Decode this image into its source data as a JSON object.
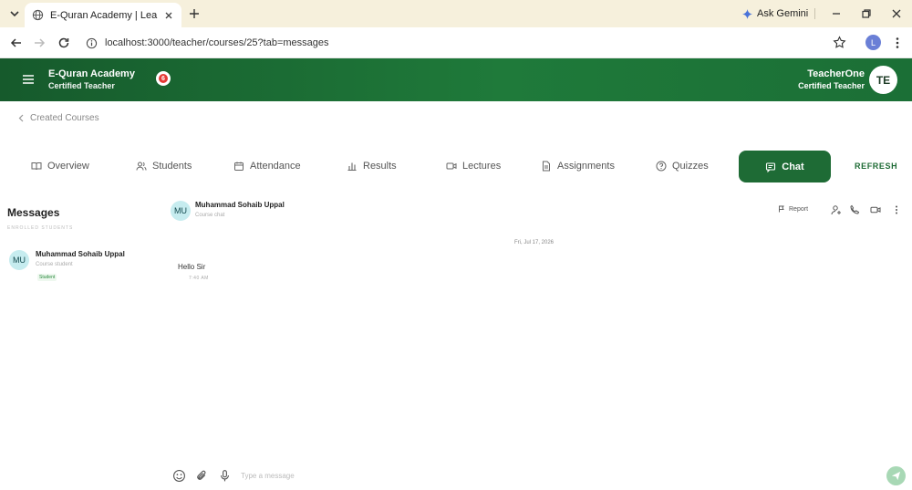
{
  "browser": {
    "tab_title": "E-Quran Academy | Learn Qur...",
    "gemini_label": "Ask Gemini",
    "url": "localhost:3000/teacher/courses/25?tab=messages",
    "profile_initial": "L"
  },
  "header": {
    "brand_name": "E-Quran Academy",
    "brand_sub": "Certified Teacher",
    "notification_count": "6",
    "user_name": "TeacherOne",
    "user_sub": "Certified Teacher",
    "user_initials": "TE"
  },
  "breadcrumb": {
    "back_label": "Created Courses"
  },
  "course_tabs": [
    {
      "label": "Overview",
      "icon": "book-icon"
    },
    {
      "label": "Students",
      "icon": "users-icon"
    },
    {
      "label": "Attendance",
      "icon": "calendar-icon"
    },
    {
      "label": "Results",
      "icon": "bar-chart-icon"
    },
    {
      "label": "Lectures",
      "icon": "video-icon"
    },
    {
      "label": "Assignments",
      "icon": "file-icon"
    },
    {
      "label": "Quizzes",
      "icon": "help-circle-icon"
    },
    {
      "label": "Chat",
      "icon": "chat-icon",
      "active": true
    }
  ],
  "refresh_label": "REFRESH",
  "messages_panel": {
    "title": "Messages",
    "section_label": "ENROLLED STUDENTS",
    "contacts": [
      {
        "initials": "MU",
        "name": "Muhammad Sohaib Uppal",
        "role": "Course student",
        "badge": "Student"
      }
    ]
  },
  "chat": {
    "initials": "MU",
    "name": "Muhammad Sohaib Uppal",
    "subtitle": "Course chat",
    "report_label": "Report",
    "date_label": "Fri, Jul 17, 2026",
    "messages": [
      {
        "text": "Hello Sir",
        "time": "7:40 AM"
      }
    ],
    "composer_placeholder": "Type a message"
  },
  "colors": {
    "header_green": "#1f7a3a",
    "active_tab": "#1e6b35",
    "avatar_bg": "#c6ecef",
    "badge_red": "#e53935",
    "send_button": "#a8d8b5"
  }
}
